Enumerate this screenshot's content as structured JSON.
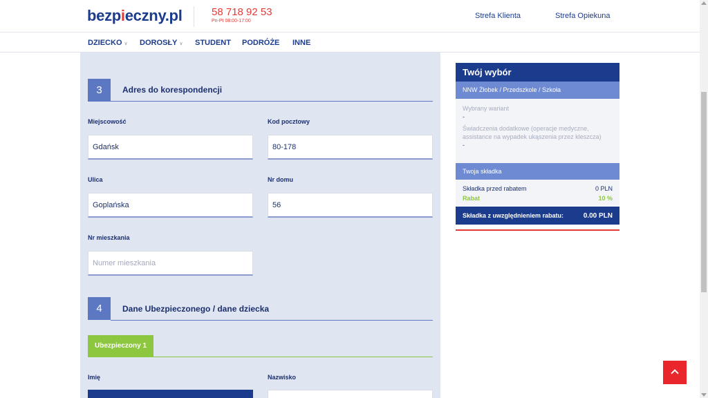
{
  "header": {
    "logo_text": "bezpieczny.pl",
    "phone": "58 718 92 53",
    "hours": "Pn-Pt 08:00-17:00",
    "links": [
      "Strefa Klienta",
      "Strefa Opiekuna"
    ]
  },
  "nav": {
    "items": [
      {
        "label": "DZIECKO",
        "dropdown": true
      },
      {
        "label": "DOROSŁY",
        "dropdown": true
      },
      {
        "label": "STUDENT",
        "dropdown": false
      },
      {
        "label": "PODRÓŻE",
        "dropdown": false
      },
      {
        "label": "INNE",
        "dropdown": false
      }
    ]
  },
  "form": {
    "section3": {
      "number": "3",
      "title": "Adres do korespondencji",
      "fields": {
        "city": {
          "label": "Miejscowość",
          "value": "Gdańsk"
        },
        "postal": {
          "label": "Kod pocztowy",
          "value": "80-178"
        },
        "street": {
          "label": "Ulica",
          "value": "Goplańska"
        },
        "house": {
          "label": "Nr domu",
          "value": "56"
        },
        "apartment": {
          "label": "Nr mieszkania",
          "value": "",
          "placeholder": "Numer mieszkania"
        }
      }
    },
    "section4": {
      "number": "4",
      "title": "Dane Ubezpieczonego / dane dziecka",
      "tab_label": "Ubezpieczony 1",
      "fields": {
        "first_name": {
          "label": "Imię",
          "value": ""
        },
        "last_name": {
          "label": "Nazwisko",
          "value": ""
        }
      }
    }
  },
  "summary": {
    "title": "Twój wybór",
    "product": "NNW Żłobek / Przedszkole / Szkoła",
    "variant_label": "Wybrany wariant",
    "variant_value": "-",
    "extras_label": "Świadczenia dodatkowe (operacje medyczne, assistance na wypadek ukąszenia przez kleszcza)",
    "extras_value": "-",
    "premium_header": "Twoja składka",
    "before_discount_label": "Składka przed rabatem",
    "before_discount_value": "0 PLN",
    "discount_label": "Rabat",
    "discount_value": "10 %",
    "total_label": "Składka z uwzględnieniem rabatu:",
    "total_value": "0.00 PLN"
  },
  "colors": {
    "brand_blue": "#1b3b8c",
    "accent_red": "#e53935",
    "accent_green": "#8dc63f",
    "panel_bg": "#e0e5f2"
  }
}
